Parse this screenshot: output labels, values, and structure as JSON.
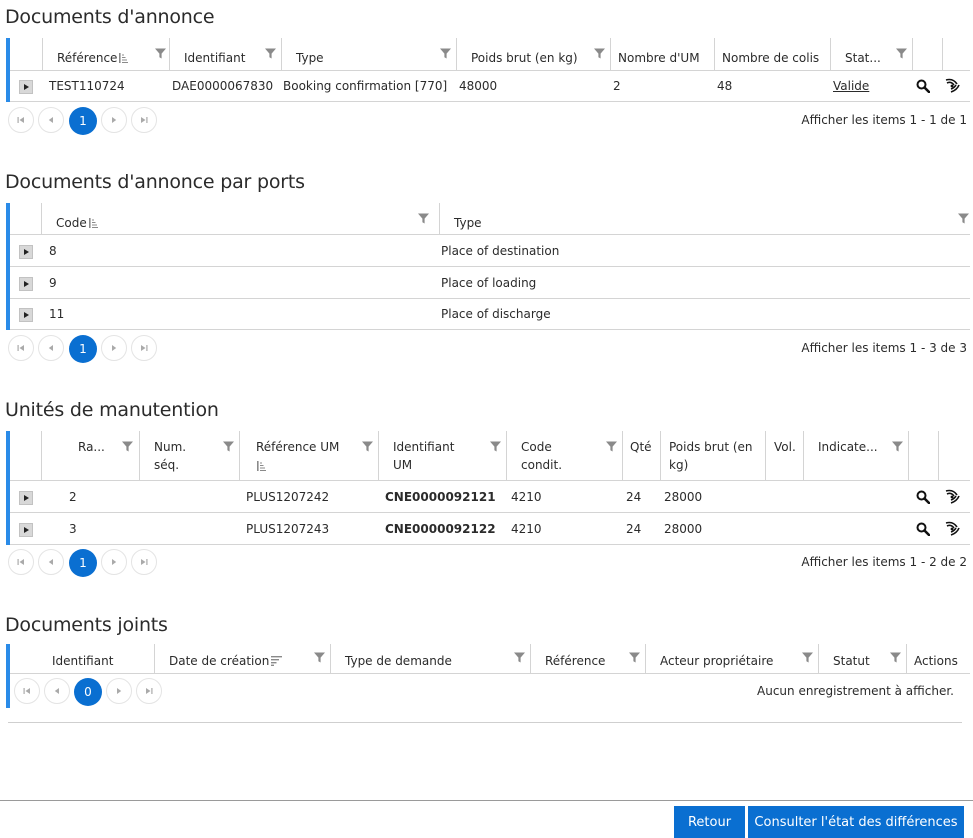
{
  "sections": {
    "docs": {
      "title": "Documents d'annonce",
      "headers": [
        "Référence",
        "Identifiant",
        "Type",
        "Poids brut (en kg)",
        "Nombre d'UM",
        "Nombre de colis",
        "Stat..."
      ],
      "rows": [
        {
          "reference": "TEST110724",
          "identifiant": "DAE0000067830",
          "type": "Booking confirmation [770]",
          "poids": "48000",
          "nb_um": "2",
          "nb_colis": "48",
          "statut": "Valide"
        }
      ],
      "page": "1",
      "info": "Afficher les items 1 - 1 de 1"
    },
    "ports": {
      "title": "Documents d'annonce par ports",
      "headers": [
        "Code",
        "Type"
      ],
      "rows": [
        {
          "code": "8",
          "type": "Place of destination"
        },
        {
          "code": "9",
          "type": "Place of loading"
        },
        {
          "code": "11",
          "type": "Place of discharge"
        }
      ],
      "page": "1",
      "info": "Afficher les items 1 - 3 de 3"
    },
    "um": {
      "title": "Unités de manutention",
      "headers": [
        "Ra...",
        "Num.",
        "séq.",
        "Référence UM",
        "Identifiant",
        "UM",
        "Code",
        "condit.",
        "Qté",
        "Poids brut (en",
        "kg)",
        "Vol.",
        "Indicate..."
      ],
      "rows": [
        {
          "rang": "2",
          "ref": "PLUS1207242",
          "id": "CNE0000092121",
          "code": "4210",
          "qte": "24",
          "poids": "28000"
        },
        {
          "rang": "3",
          "ref": "PLUS1207243",
          "id": "CNE0000092122",
          "code": "4210",
          "qte": "24",
          "poids": "28000"
        }
      ],
      "page": "1",
      "info": "Afficher les items 1 - 2 de 2"
    },
    "joints": {
      "title": "Documents joints",
      "headers": [
        "Identifiant",
        "Date de création",
        "Type de demande",
        "Référence",
        "Acteur propriétaire",
        "Statut",
        "Actions"
      ],
      "page": "0",
      "info": "Aucun enregistrement à afficher."
    }
  },
  "footer": {
    "back": "Retour",
    "diff": "Consulter l'état des différences"
  },
  "colors": {
    "accent": "#2a8be8",
    "primary": "#0a6fd1",
    "border": "#d4d4d4"
  },
  "icons": [
    "filter-icon",
    "sort-icon",
    "expand-icon",
    "magnifier-icon",
    "signal-icon",
    "first-page-icon",
    "prev-page-icon",
    "next-page-icon",
    "last-page-icon"
  ]
}
